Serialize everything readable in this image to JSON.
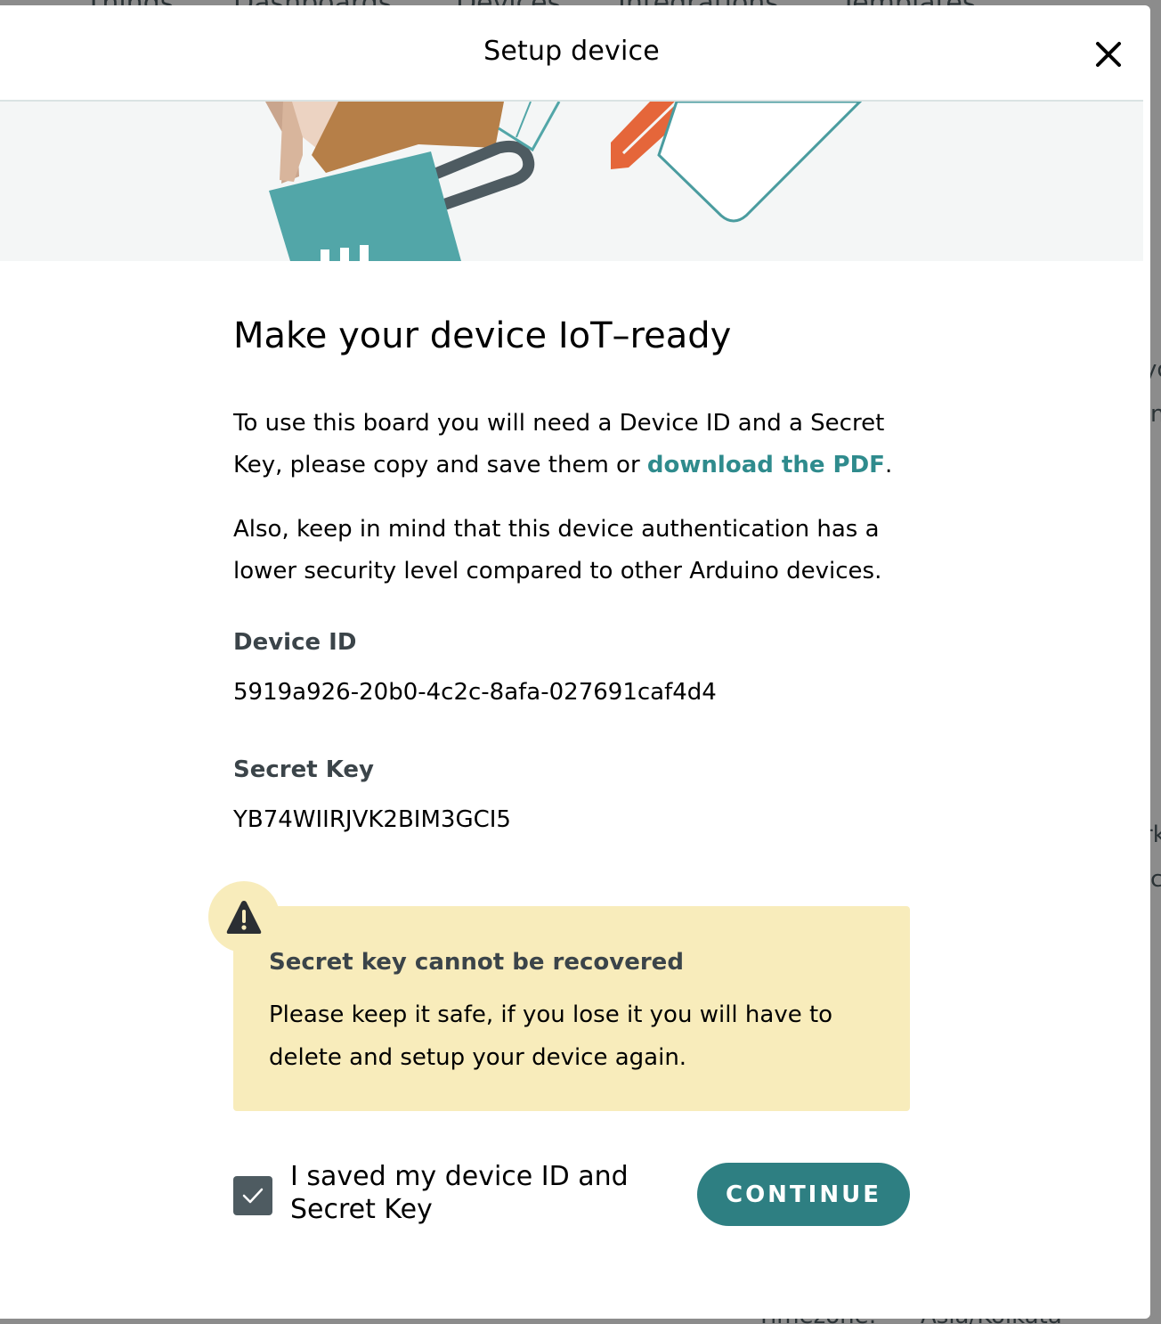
{
  "background": {
    "nav_items": [
      "Things",
      "Dashboards",
      "Devices",
      "Integrations",
      "Templates"
    ],
    "side_fragments": [
      "yo",
      "n",
      "rk",
      "c"
    ],
    "footer_fragments": [
      "Timezone:",
      "Asia/Kolkata"
    ]
  },
  "modal": {
    "title": "Setup device",
    "close_icon": "close-icon",
    "heading": "Make your device IoT–ready",
    "intro_before_link": "To use this board you will need a Device ID and a Secret Key, please copy and save them or ",
    "intro_link": "download the PDF",
    "intro_after_link": ".",
    "security_note": "Also, keep in mind that this device authentication has a lower security level compared to other Arduino devices.",
    "device_id_label": "Device ID",
    "device_id_value": "5919a926-20b0-4c2c-8afa-027691caf4d4",
    "secret_key_label": "Secret Key",
    "secret_key_value": "YB74WIIRJVK2BIM3GCI5",
    "warning": {
      "icon": "warning-icon",
      "title": "Secret key cannot be recovered",
      "text": "Please keep it safe, if you lose it you will have to delete and setup your device again."
    },
    "checkbox": {
      "checked": true,
      "label": "I saved my device ID and Secret Key"
    },
    "continue_label": "CONTINUE"
  },
  "colors": {
    "accent": "#2e7f82",
    "link": "#2f8b8d",
    "warning_bg": "#f8ecbb",
    "checkbox_bg": "#4e5b61"
  }
}
